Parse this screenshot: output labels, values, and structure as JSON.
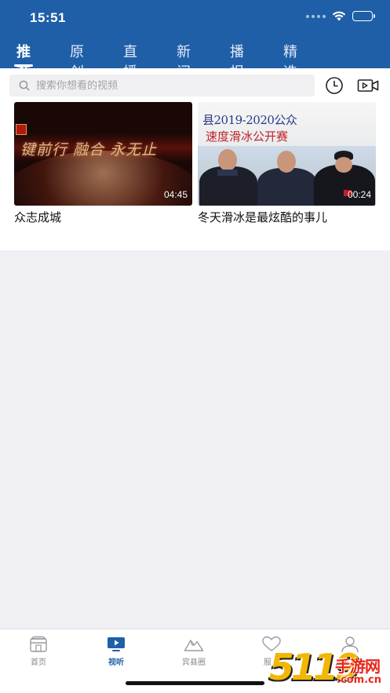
{
  "status_bar": {
    "time": "15:51"
  },
  "tabs": [
    {
      "label": "推荐",
      "active": true
    },
    {
      "label": "原创",
      "active": false
    },
    {
      "label": "直播",
      "active": false
    },
    {
      "label": "新闻",
      "active": false
    },
    {
      "label": "播报",
      "active": false
    },
    {
      "label": "精选",
      "active": false
    }
  ],
  "search": {
    "placeholder": "搜索你想看的视频",
    "value": ""
  },
  "header_icons": [
    "history-clock-icon",
    "video-camera-icon"
  ],
  "videos": [
    {
      "title": "众志成城",
      "duration": "04:45",
      "thumbnail_text": "键前行  融合  永无止"
    },
    {
      "title": "冬天滑冰是最炫酷的事儿",
      "duration": "00:24",
      "thumbnail_text": "县2019-2020公众",
      "thumbnail_subtext": "速度滑冰公开赛"
    }
  ],
  "bottom_nav": [
    {
      "label": "首页",
      "icon": "home-icon",
      "active": false
    },
    {
      "label": "视听",
      "icon": "tv-icon",
      "active": true
    },
    {
      "label": "宾县圈",
      "icon": "mountain-icon",
      "active": false
    },
    {
      "label": "服务",
      "icon": "heart-icon",
      "active": false
    },
    {
      "label": "我的",
      "icon": "person-icon",
      "active": false
    }
  ],
  "colors": {
    "brand": "#1f5fa8",
    "background": "#efeff4",
    "inactive_nav": "#8a8a8f"
  },
  "watermark": {
    "number": "5119",
    "brand": "手游网",
    "url": ".com.cn"
  }
}
